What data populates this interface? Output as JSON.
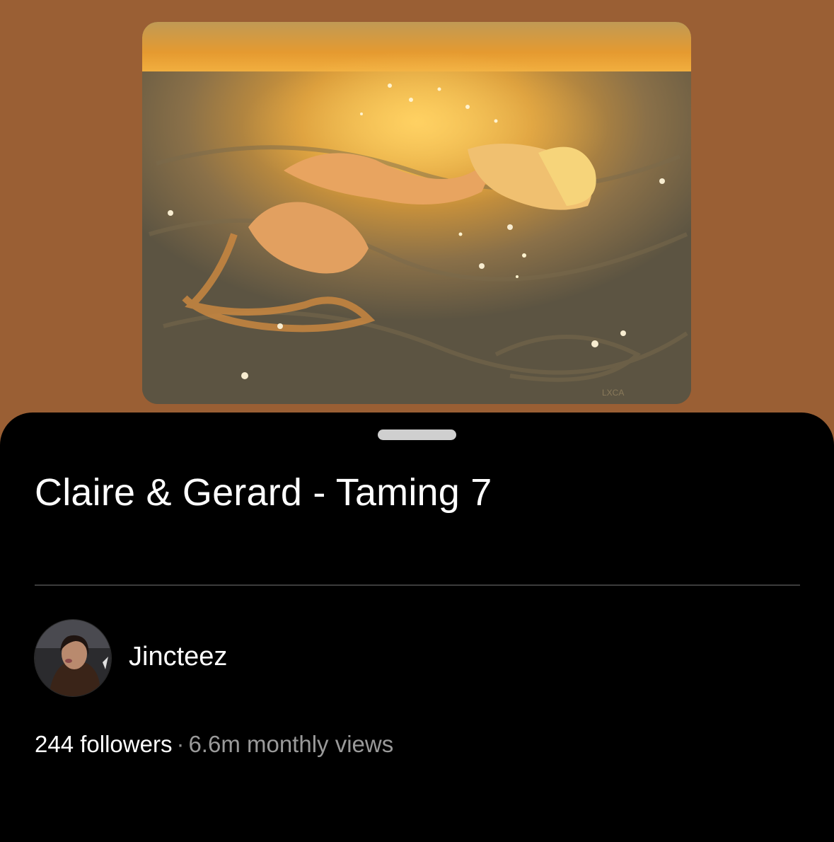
{
  "board": {
    "title": "Claire & Gerard - Taming 7",
    "artwork_icon": "artwork-image",
    "artwork_signature": "LXCA"
  },
  "creator": {
    "username": "Jincteez",
    "avatar_icon": "avatar-photo",
    "followers": "244 followers",
    "separator": "·",
    "monthly_views": "6.6m monthly views"
  },
  "colors": {
    "header_background": "#9a5f34",
    "sheet_background": "#000000",
    "text_primary": "#ffffff",
    "text_secondary": "#9a9a9a",
    "divider": "#3c3c3c"
  }
}
